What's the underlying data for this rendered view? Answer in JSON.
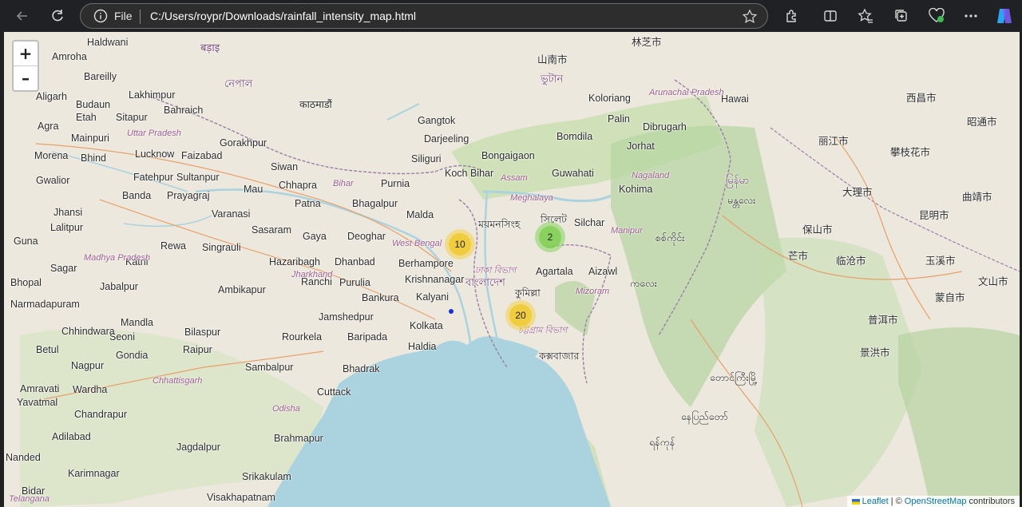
{
  "browser": {
    "file_label": "File",
    "url": "C:/Users/roypr/Downloads/rainfall_intensity_map.html"
  },
  "map": {
    "zoom_in": "+",
    "zoom_out": "–",
    "clusters": [
      {
        "count": "10",
        "color": "#f1d357"
      },
      {
        "count": "2",
        "color": "#8ed66b"
      },
      {
        "count": "20",
        "color": "#f1d357"
      }
    ],
    "labels": [
      "Haldwani",
      "Amroha",
      "Bareilly",
      "Aligarh",
      "Budaun",
      "Etah",
      "Agra",
      "Mainpuri",
      "Morena",
      "Bhind",
      "Gwalior",
      "Jhansi",
      "Lalitpur",
      "Guna",
      "Sagar",
      "Bhopal",
      "Narmadapuram",
      "Lakhimpur",
      "Bahraich",
      "Sitapur",
      "Lucknow",
      "Faizabad",
      "Fatehpur",
      "Sultanpur",
      "Banda",
      "Prayagraj",
      "Mau",
      "Varanasi",
      "Rewa",
      "Katni",
      "Jabalpur",
      "Singrauli",
      "Mandla",
      "Seoni",
      "Chhindwara",
      "Betul",
      "Nagpur",
      "Gondia",
      "Amravati",
      "Wardha",
      "Yavatmal",
      "Chandrapur",
      "Adilabad",
      "Nanded",
      "Karimnagar",
      "Bidar",
      "Visakhapatnam",
      "Srikakulam",
      "Jagdalpur",
      "Brahmapur",
      "Cuttack",
      "Bhadrak",
      "Baripada",
      "Rourkela",
      "Bilaspur",
      "Raipur",
      "Sambalpur",
      "Jamshedpur",
      "Ranchi",
      "Ambikapur",
      "Hazaribagh",
      "Dhanbad",
      "Purulia",
      "Bankura",
      "Sasaram",
      "Gaya",
      "Deoghar",
      "Patna",
      "Chhapra",
      "Siwan",
      "Gorakhpur",
      "Bhagalpur",
      "Malda",
      "Berhampore",
      "Krishnanagar",
      "Kalyani",
      "Kolkata",
      "Haldia",
      "Siliguri",
      "Darjeeling",
      "Gangtok",
      "Koch Bihar",
      "Bongaigaon",
      "Guwahati",
      "Kohima",
      "Silchar",
      "Agartala",
      "Aizawl",
      "Bomdila",
      "Jorhat",
      "Dibrugarh",
      "Koloriang",
      "Palin",
      "Hawai",
      "Purnia"
    ],
    "regions": [
      "Uttar Pradesh",
      "Madhya Pradesh",
      "Chhattisgarh",
      "Jharkhand",
      "Bihar",
      "West Bengal",
      "Odisha",
      "Telangana",
      "Assam",
      "Meghalaya",
      "Nagaland",
      "Manipur",
      "Mizoram",
      "Arunachal Pradesh"
    ],
    "script_labels": [
      "बड़ाइ",
      "নেপাল",
      "काठमाडौं",
      "বাংলাদেশ",
      "ময়মনসিংহ",
      "সিলেট",
      "কুমিল্লা",
      "ঢাকা বিভাগ",
      "চট্টগ্রাম বিভাগ",
      "কক্সবাজার",
      "ভুটান",
      "မြန်မာ",
      "မန္တလေး",
      "စစ်ကိုင်း",
      "ကလေး",
      "တောင်ကြီးမြို့",
      "နေပြည်တော်",
      "ရန်ကုန်",
      "丽江市",
      "大理市",
      "昆明市",
      "保山市",
      "临沧市",
      "普洱市",
      "景洪市",
      "攀枝花市",
      "西昌市",
      "昭通市",
      "曲靖市",
      "玉溪市",
      "蒙自市",
      "文山市",
      "芒市",
      "林芝市",
      "山南市"
    ],
    "attribution": {
      "leaflet": "Leaflet",
      "sep": "| ©",
      "osm": "OpenStreetMap",
      "rest": "contributors"
    },
    "colors": {
      "land": "#ede8dd",
      "water": "#aad3df",
      "forest": "#add19e",
      "park": "#c8e0b4"
    }
  }
}
